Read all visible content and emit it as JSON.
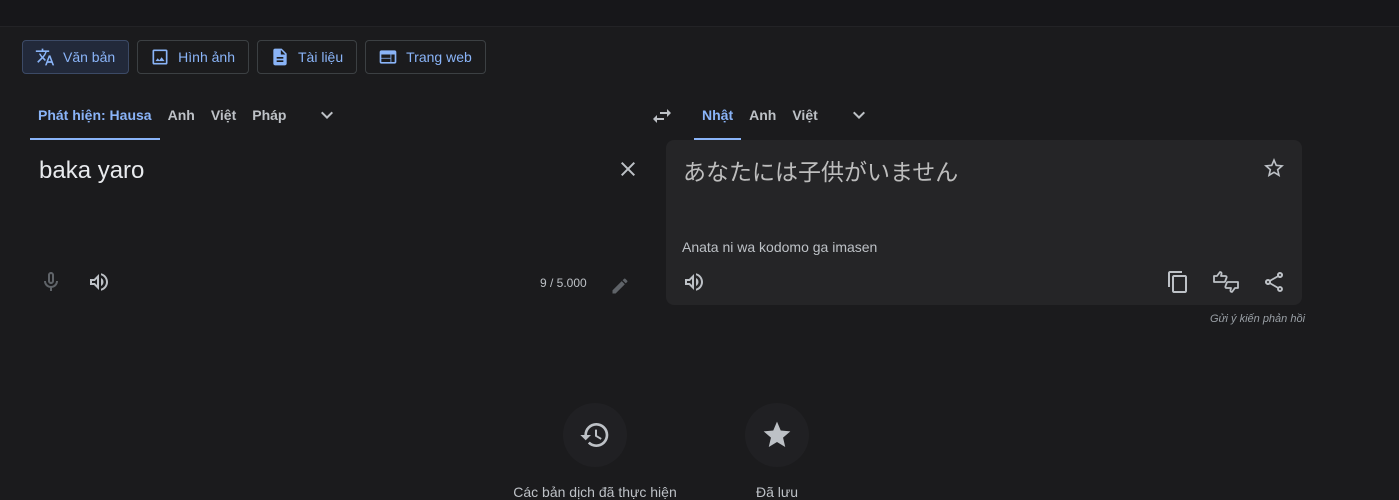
{
  "mode_tabs": [
    {
      "label": "Văn bản",
      "icon": "translate-icon"
    },
    {
      "label": "Hình ảnh",
      "icon": "image-icon"
    },
    {
      "label": "Tài liệu",
      "icon": "document-icon"
    },
    {
      "label": "Trang web",
      "icon": "web-icon"
    }
  ],
  "source_langs": [
    "Phát hiện: Hausa",
    "Anh",
    "Việt",
    "Pháp"
  ],
  "target_langs": [
    "Nhật",
    "Anh",
    "Việt"
  ],
  "source": {
    "text": "baka yaro",
    "char_count": "9 / 5.000"
  },
  "target": {
    "text": "あなたには子供がいません",
    "romanization": "Anata ni wa kodomo ga imasen"
  },
  "feedback_label": "Gửi ý kiến phản hồi",
  "bottom": {
    "history_label": "Các bản dịch đã thực hiện",
    "saved_label": "Đã lưu"
  },
  "colors": {
    "accent": "#8ab4f8",
    "background": "#1b1b1d",
    "panel": "#252527"
  }
}
